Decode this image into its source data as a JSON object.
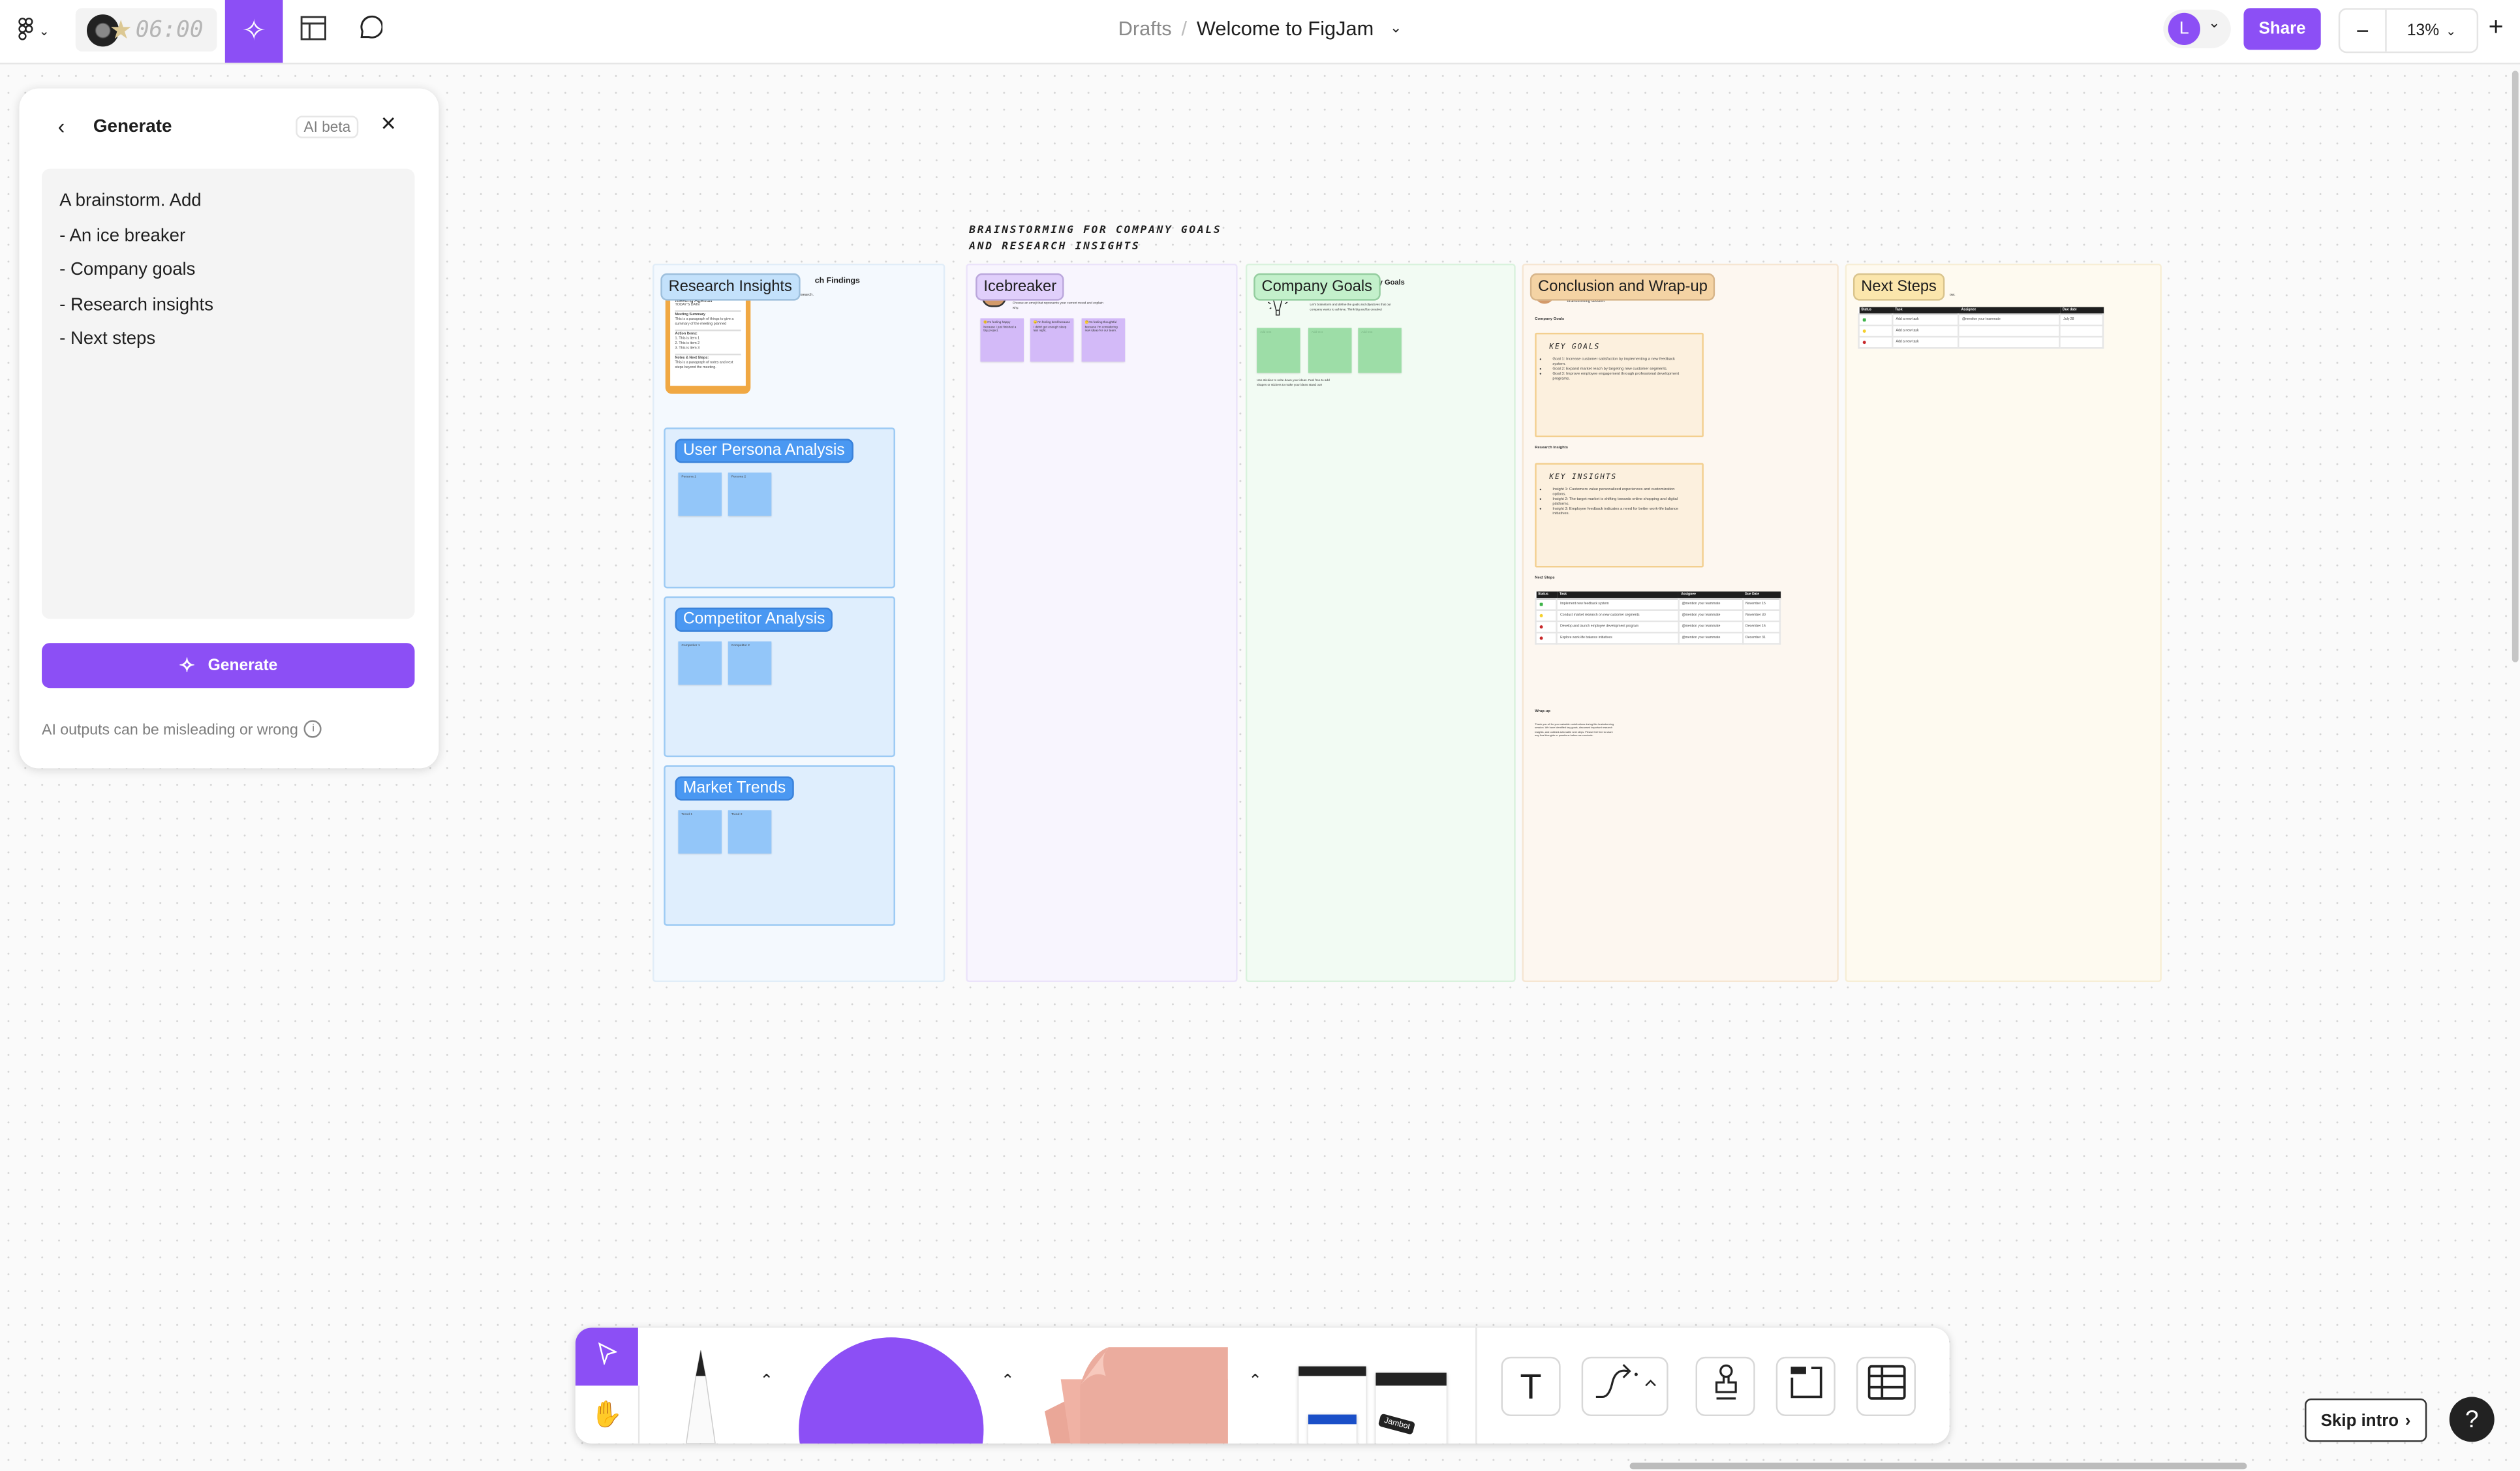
{
  "colors": {
    "accent": "#8c4ff5",
    "research": "#c3e1fb",
    "icebreaker": "#e0cffb",
    "company_goals": "#c3f0cb",
    "conclusion": "#f4d3a4",
    "next_steps": "#fbe6ac"
  },
  "topbar": {
    "menu_icon": "figma-logo-icon",
    "timer": "06:00",
    "breadcrumb_parent": "Drafts",
    "breadcrumb_sep": "/",
    "file_name": "Welcome to FigJam",
    "avatar_initial": "L",
    "share_label": "Share",
    "zoom_level": "13%",
    "zoom_out": "−",
    "zoom_in": "+"
  },
  "generate_panel": {
    "title": "Generate",
    "badge": "AI beta",
    "prompt_lines": [
      "A brainstorm. Add",
      "- An ice breaker",
      "- Company goals",
      "- Research insights",
      "- Next steps"
    ],
    "button_label": "Generate",
    "disclaimer": "AI outputs can be misleading or wrong"
  },
  "board": {
    "heading": [
      "BRAINSTORMING FOR COMPANY GOALS",
      "AND RESEARCH INSIGHTS"
    ],
    "research": {
      "label": "Research Insights",
      "title_fragment": "ch Findings",
      "desc_fragment": "portant insights from the research.",
      "agenda": {
        "title": "Meeting Agenda",
        "date": "TODAY'S DATE",
        "summary_h": "Meeting Summary",
        "summary": "This is a paragraph of things to give a summary of the meeting planned",
        "actions_h": "Action Items:",
        "actions": [
          "1. This is item 1",
          "2. This is item 2",
          "3. This is item 3"
        ],
        "notes_h": "Notes & Next Steps:",
        "notes": "This is a paragraph of notes and next steps beyond the meeting."
      },
      "sections": [
        {
          "label": "User Persona Analysis",
          "stickies": [
            "Persona 1",
            "Persona 2"
          ]
        },
        {
          "label": "Competitor Analysis",
          "stickies": [
            "Competitor 1",
            "Competitor 2"
          ]
        },
        {
          "label": "Market Trends",
          "stickies": [
            "Trend 1",
            "Trend 2"
          ]
        }
      ]
    },
    "icebreaker": {
      "label": "Icebreaker",
      "desc": "Choose an emoji that represents your current mood and explain why.",
      "stickies": [
        "😊I'm feeling happy because I just finished a big project.",
        "😴I'm feeling tired because I didn't get enough sleep last night.",
        "🤔I'm feeling thoughtful because I'm considering new ideas for our team."
      ]
    },
    "company_goals": {
      "label": "Company Goals",
      "title_fragment": "ny Goals",
      "desc": "Let's brainstorm and define the goals and objectives that our company wants to achieve. Think big and be creative!",
      "stickies": [
        "Add text",
        "Add text",
        "Add text"
      ],
      "footer": "Use stickies to write down your ideas. Feel free to add shapes or stickers to make your ideas stand out!"
    },
    "conclusion": {
      "label": "Conclusion and Wrap-up",
      "desc_fragment": "brainstorming session.",
      "goals_h": "Company Goals",
      "key_goals_title": "KEY GOALS",
      "key_goals": [
        "Goal 1: Increase customer satisfaction by implementing a new feedback system.",
        "Goal 2: Expand market reach by targeting new customer segments.",
        "Goal 3: Improve employee engagement through professional development programs."
      ],
      "insights_h": "Research Insights",
      "key_insights_title": "KEY INSIGHTS",
      "key_insights": [
        "Insight 1: Customers value personalized experiences and customization options.",
        "Insight 2: The target market is shifting towards online shopping and digital platforms.",
        "Insight 3: Employee feedback indicates a need for better work-life balance initiatives."
      ],
      "next_h": "Next Steps",
      "table": {
        "headers": [
          "Status",
          "Task",
          "Assignee",
          "Due Date"
        ],
        "rows": [
          {
            "status": "done",
            "task": "Implement new feedback system",
            "assignee": "@mention your teammate",
            "due": "November 15"
          },
          {
            "status": "in-progress",
            "task": "Conduct market research on new customer segments",
            "assignee": "@mention your teammate",
            "due": "November 30"
          },
          {
            "status": "not-started",
            "task": "Develop and launch employee development program",
            "assignee": "@mention your teammate",
            "due": "December 15"
          },
          {
            "status": "not-started",
            "task": "Explore work-life balance initiatives",
            "assignee": "@mention your teammate",
            "due": "December 31"
          }
        ]
      },
      "wrap_h": "Wrap-up",
      "wrap_text": "Thank you all for your valuable contributions during this brainstorming session. We have identified key goals, discussed important research insights, and outlined actionable next steps. Please feel free to share any final thoughts or questions before we conclude."
    },
    "next_steps": {
      "label": "Next Steps",
      "desc_fragment": "ow.",
      "table": {
        "headers": [
          "Status",
          "Task",
          "Assignee",
          "Due date"
        ],
        "rows": [
          {
            "status": "done",
            "task": "Add a new task",
            "assignee": "@mention your teammate",
            "due": "July 28"
          },
          {
            "status": "in-progress",
            "task": "Add a new task",
            "assignee": "",
            "due": ""
          },
          {
            "status": "not-started",
            "task": "Add a new task",
            "assignee": "",
            "due": ""
          }
        ]
      }
    }
  },
  "status_colors": {
    "done": "#3fb44a",
    "in-progress": "#f5cf2c",
    "not-started": "#c8282a"
  },
  "toolbar": {
    "tools": [
      "select",
      "hand",
      "marker",
      "shape",
      "sticky-note",
      "templates",
      "text",
      "connector",
      "stamp",
      "section",
      "table"
    ],
    "template_card_text": "Jambot"
  },
  "skip_intro": "Skip intro",
  "help": "?"
}
